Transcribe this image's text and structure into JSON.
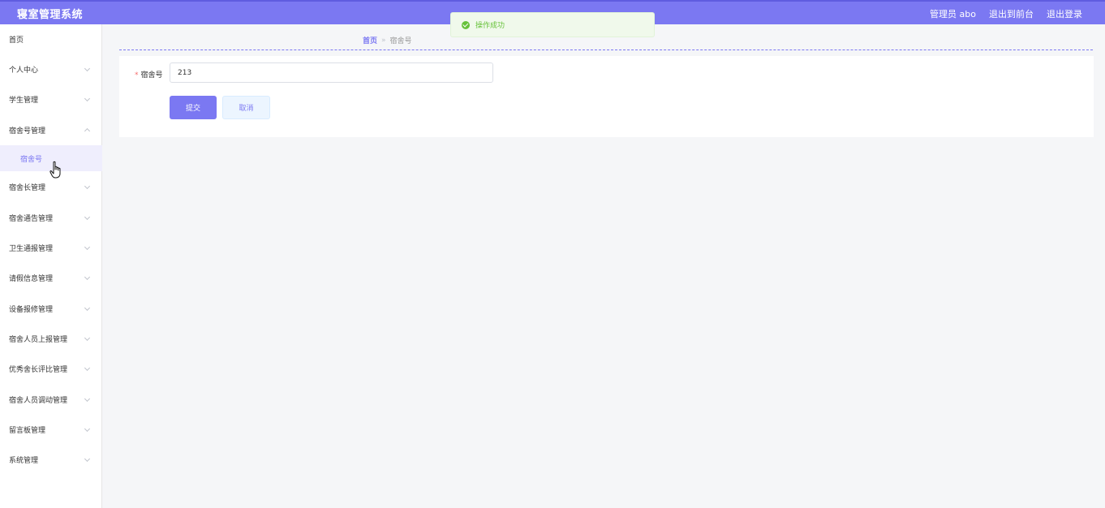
{
  "header": {
    "title": "寝室管理系统",
    "user_label": "管理员 abo",
    "to_front": "退出到前台",
    "logout": "退出登录",
    "bg_color": "#7b78f2"
  },
  "toast": {
    "icon": "check-circle-icon",
    "message": "操作成功",
    "color": "#67c23a"
  },
  "sidebar": {
    "items": [
      {
        "label": "首页",
        "has_children": false
      },
      {
        "label": "个人中心",
        "has_children": true
      },
      {
        "label": "学生管理",
        "has_children": true
      },
      {
        "label": "宿舍号管理",
        "has_children": true,
        "expanded": true
      },
      {
        "label": "宿舍长管理",
        "has_children": true
      },
      {
        "label": "宿舍通告管理",
        "has_children": true
      },
      {
        "label": "卫生通报管理",
        "has_children": true
      },
      {
        "label": "请假信息管理",
        "has_children": true
      },
      {
        "label": "设备报修管理",
        "has_children": true
      },
      {
        "label": "宿舍人员上报管理",
        "has_children": true
      },
      {
        "label": "优秀舍长评比管理",
        "has_children": true
      },
      {
        "label": "宿舍人员调动管理",
        "has_children": true
      },
      {
        "label": "留言板管理",
        "has_children": true
      },
      {
        "label": "系统管理",
        "has_children": true
      }
    ],
    "active_sub": "宿舍号"
  },
  "breadcrumb": {
    "home": "首页",
    "separator": "»",
    "current": "宿舍号"
  },
  "form": {
    "field_label": "宿舍号",
    "field_value": "213",
    "submit_label": "提交",
    "cancel_label": "取消"
  }
}
